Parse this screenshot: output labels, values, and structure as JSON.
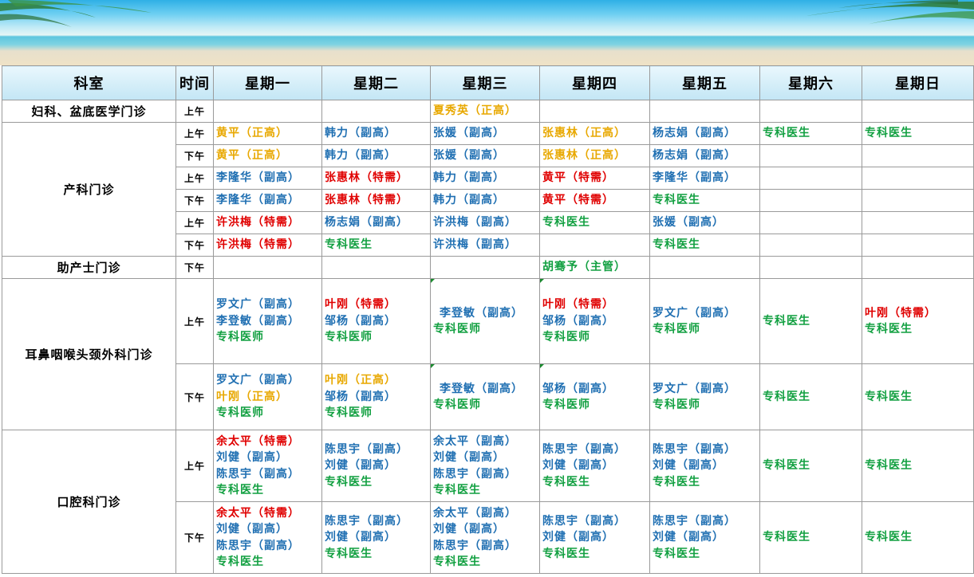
{
  "header": {
    "dept": "科室",
    "time": "时间",
    "days": [
      "星期一",
      "星期二",
      "星期三",
      "星期四",
      "星期五",
      "星期六",
      "星期日"
    ]
  },
  "colors": {
    "orange": "#e8a800",
    "blue": "#1f6fb2",
    "red": "#e00000",
    "green": "#12a041"
  },
  "departments": [
    {
      "name": "妇科、盆底医学门诊"
    },
    {
      "name": "产科门诊"
    },
    {
      "name": "助产士门诊"
    },
    {
      "name": "耳鼻咽喉头颈外科门诊"
    },
    {
      "name": "口腔科门诊"
    }
  ],
  "rows": [
    {
      "time": "上午",
      "cells": [
        [],
        [],
        [
          {
            "t": "夏秀英（正高）",
            "c": "orange"
          }
        ],
        [],
        [],
        [],
        []
      ]
    },
    {
      "time": "上午",
      "cells": [
        [
          {
            "t": "黄平（正高）",
            "c": "orange"
          }
        ],
        [
          {
            "t": "韩力（副高）",
            "c": "blue"
          }
        ],
        [
          {
            "t": "张媛（副高）",
            "c": "blue"
          }
        ],
        [
          {
            "t": "张惠林（正高）",
            "c": "orange"
          }
        ],
        [
          {
            "t": "杨志娟（副高）",
            "c": "blue"
          }
        ],
        [
          {
            "t": "专科医生",
            "c": "green"
          }
        ],
        [
          {
            "t": "专科医生",
            "c": "green"
          }
        ]
      ]
    },
    {
      "time": "下午",
      "cells": [
        [
          {
            "t": "黄平（正高）",
            "c": "orange"
          }
        ],
        [
          {
            "t": "韩力（副高）",
            "c": "blue"
          }
        ],
        [
          {
            "t": "张媛（副高）",
            "c": "blue"
          }
        ],
        [
          {
            "t": "张惠林（正高）",
            "c": "orange"
          }
        ],
        [
          {
            "t": "杨志娟（副高）",
            "c": "blue"
          }
        ],
        [],
        []
      ]
    },
    {
      "time": "上午",
      "cells": [
        [
          {
            "t": "李隆华（副高）",
            "c": "blue"
          }
        ],
        [
          {
            "t": "张惠林（特需）",
            "c": "red"
          }
        ],
        [
          {
            "t": "韩力（副高）",
            "c": "blue"
          }
        ],
        [
          {
            "t": "黄平（特需）",
            "c": "red"
          }
        ],
        [
          {
            "t": "李隆华（副高）",
            "c": "blue"
          }
        ],
        [],
        []
      ]
    },
    {
      "time": "下午",
      "cells": [
        [
          {
            "t": "李隆华（副高）",
            "c": "blue"
          }
        ],
        [
          {
            "t": "张惠林（特需）",
            "c": "red"
          }
        ],
        [
          {
            "t": "韩力（副高）",
            "c": "blue"
          }
        ],
        [
          {
            "t": "黄平（特需）",
            "c": "red"
          }
        ],
        [
          {
            "t": "专科医生",
            "c": "green"
          }
        ],
        [],
        []
      ]
    },
    {
      "time": "上午",
      "cells": [
        [
          {
            "t": "许洪梅（特需）",
            "c": "red"
          }
        ],
        [
          {
            "t": "杨志娟（副高）",
            "c": "blue"
          }
        ],
        [
          {
            "t": "许洪梅（副高）",
            "c": "blue"
          }
        ],
        [
          {
            "t": "专科医生",
            "c": "green"
          }
        ],
        [
          {
            "t": "张媛（副高）",
            "c": "blue"
          }
        ],
        [],
        []
      ]
    },
    {
      "time": "下午",
      "cells": [
        [
          {
            "t": "许洪梅（特需）",
            "c": "red"
          }
        ],
        [
          {
            "t": "专科医生",
            "c": "green"
          }
        ],
        [
          {
            "t": "许洪梅（副高）",
            "c": "blue"
          }
        ],
        [],
        [
          {
            "t": "专科医生",
            "c": "green"
          }
        ],
        [],
        []
      ]
    },
    {
      "time": "下午",
      "cells": [
        [],
        [],
        [],
        [
          {
            "t": "胡骞予（主管）",
            "c": "green"
          }
        ],
        [],
        [],
        []
      ]
    },
    {
      "time": "上午",
      "cells": [
        [
          {
            "t": "罗文广（副高）",
            "c": "blue"
          },
          {
            "t": "李登敏（副高）",
            "c": "blue"
          },
          {
            "t": "专科医师",
            "c": "green"
          }
        ],
        [
          {
            "t": "叶刚（特需）",
            "c": "red"
          },
          {
            "t": "邹杨（副高）",
            "c": "blue"
          },
          {
            "t": "专科医师",
            "c": "green"
          }
        ],
        [
          {
            "t": "李登敏（副高）",
            "c": "blue"
          },
          {
            "t": "专科医师",
            "c": "green"
          }
        ],
        [
          {
            "t": "叶刚（特需）",
            "c": "red"
          },
          {
            "t": "邹杨（副高）",
            "c": "blue"
          },
          {
            "t": "专科医师",
            "c": "green"
          }
        ],
        [
          {
            "t": "罗文广（副高）",
            "c": "blue"
          },
          {
            "t": "专科医师",
            "c": "green"
          }
        ],
        [
          {
            "t": "专科医生",
            "c": "green"
          }
        ],
        [
          {
            "t": "叶刚（特需）",
            "c": "red"
          },
          {
            "t": "专科医生",
            "c": "green"
          }
        ]
      ]
    },
    {
      "time": "下午",
      "cells": [
        [
          {
            "t": "罗文广（副高）",
            "c": "blue"
          },
          {
            "t": "叶刚（正高）",
            "c": "orange"
          },
          {
            "t": "专科医师",
            "c": "green"
          }
        ],
        [
          {
            "t": "叶刚（正高）",
            "c": "orange"
          },
          {
            "t": "邹杨（副高）",
            "c": "blue"
          },
          {
            "t": "专科医师",
            "c": "green"
          }
        ],
        [
          {
            "t": "李登敏（副高）",
            "c": "blue"
          },
          {
            "t": "专科医师",
            "c": "green"
          }
        ],
        [
          {
            "t": "邹杨（副高）",
            "c": "blue"
          },
          {
            "t": "专科医师",
            "c": "green"
          }
        ],
        [
          {
            "t": "罗文广（副高）",
            "c": "blue"
          },
          {
            "t": "专科医师",
            "c": "green"
          }
        ],
        [
          {
            "t": "专科医生",
            "c": "green"
          }
        ],
        [
          {
            "t": "专科医生",
            "c": "green"
          }
        ]
      ]
    },
    {
      "time": "上午",
      "cells": [
        [
          {
            "t": "余太平（特需）",
            "c": "red"
          },
          {
            "t": "刘健（副高）",
            "c": "blue"
          },
          {
            "t": "陈思宇（副高）",
            "c": "blue"
          },
          {
            "t": "专科医生",
            "c": "green"
          }
        ],
        [
          {
            "t": "陈思宇（副高）",
            "c": "blue"
          },
          {
            "t": "刘健（副高）",
            "c": "blue"
          },
          {
            "t": "专科医生",
            "c": "green"
          }
        ],
        [
          {
            "t": "余太平（副高）",
            "c": "blue"
          },
          {
            "t": "刘健（副高）",
            "c": "blue"
          },
          {
            "t": "陈思宇（副高）",
            "c": "blue"
          },
          {
            "t": "专科医生",
            "c": "green"
          }
        ],
        [
          {
            "t": "陈思宇（副高）",
            "c": "blue"
          },
          {
            "t": "刘健（副高）",
            "c": "blue"
          },
          {
            "t": "专科医生",
            "c": "green"
          }
        ],
        [
          {
            "t": "陈思宇（副高）",
            "c": "blue"
          },
          {
            "t": "刘健（副高）",
            "c": "blue"
          },
          {
            "t": "专科医生",
            "c": "green"
          }
        ],
        [
          {
            "t": "专科医生",
            "c": "green"
          }
        ],
        [
          {
            "t": "专科医生",
            "c": "green"
          }
        ]
      ]
    },
    {
      "time": "下午",
      "cells": [
        [
          {
            "t": "余太平（特需）",
            "c": "red"
          },
          {
            "t": "刘健（副高）",
            "c": "blue"
          },
          {
            "t": "陈思宇（副高）",
            "c": "blue"
          },
          {
            "t": "专科医生",
            "c": "green"
          }
        ],
        [
          {
            "t": "陈思宇（副高）",
            "c": "blue"
          },
          {
            "t": "刘健（副高）",
            "c": "blue"
          },
          {
            "t": "专科医生",
            "c": "green"
          }
        ],
        [
          {
            "t": "余太平（副高）",
            "c": "blue"
          },
          {
            "t": "刘健（副高）",
            "c": "blue"
          },
          {
            "t": "陈思宇（副高）",
            "c": "blue"
          },
          {
            "t": "专科医生",
            "c": "green"
          }
        ],
        [
          {
            "t": "陈思宇（副高）",
            "c": "blue"
          },
          {
            "t": "刘健（副高）",
            "c": "blue"
          },
          {
            "t": "专科医生",
            "c": "green"
          }
        ],
        [
          {
            "t": "陈思宇（副高）",
            "c": "blue"
          },
          {
            "t": "刘健（副高）",
            "c": "blue"
          },
          {
            "t": "专科医生",
            "c": "green"
          }
        ],
        [
          {
            "t": "专科医生",
            "c": "green"
          }
        ],
        [
          {
            "t": "专科医生",
            "c": "green"
          }
        ]
      ]
    }
  ]
}
